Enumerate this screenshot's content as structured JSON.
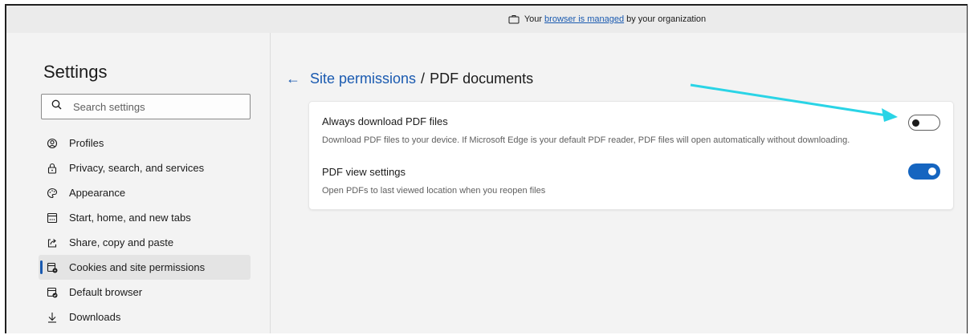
{
  "managed_bar": {
    "prefix": "Your",
    "link": "browser is managed",
    "suffix": "by your organization"
  },
  "sidebar": {
    "title": "Settings",
    "search_placeholder": "Search settings",
    "items": [
      {
        "label": "Profiles",
        "icon": "profile-icon"
      },
      {
        "label": "Privacy, search, and services",
        "icon": "lock-icon"
      },
      {
        "label": "Appearance",
        "icon": "palette-icon"
      },
      {
        "label": "Start, home, and new tabs",
        "icon": "window-icon"
      },
      {
        "label": "Share, copy and paste",
        "icon": "share-icon"
      },
      {
        "label": "Cookies and site permissions",
        "icon": "cookies-icon",
        "active": true
      },
      {
        "label": "Default browser",
        "icon": "default-browser-icon"
      },
      {
        "label": "Downloads",
        "icon": "download-icon"
      }
    ]
  },
  "main": {
    "breadcrumb": {
      "parent": "Site permissions",
      "separator": "/",
      "current": "PDF documents"
    },
    "settings": [
      {
        "title": "Always download PDF files",
        "description": "Download PDF files to your device. If Microsoft Edge is your default PDF reader, PDF files will open automatically without downloading.",
        "enabled": false
      },
      {
        "title": "PDF view settings",
        "description": "Open PDFs to last viewed location when you reopen files",
        "enabled": true
      }
    ]
  },
  "colors": {
    "accent": "#1a5ab0",
    "toggle_on": "#1565c0",
    "annotation_arrow": "#2ad4e6"
  }
}
